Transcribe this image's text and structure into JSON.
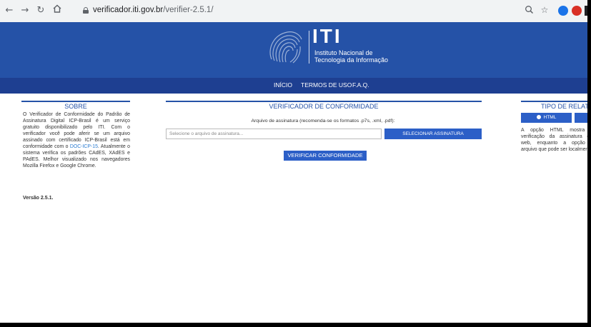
{
  "browser": {
    "url_domain": "verificador.iti.gov.br",
    "url_path": "/verifier-2.5.1/"
  },
  "header": {
    "logo_text": "ITI",
    "logo_sub_line1": "Instituto Nacional de",
    "logo_sub_line2": "Tecnologia da Informação"
  },
  "menu": [
    {
      "label": "INÍCIO"
    },
    {
      "label": "TERMOS DE USO"
    },
    {
      "label": "F.A.Q."
    }
  ],
  "about": {
    "title": "SOBRE",
    "text_before_link": "O Verificador de Conformidade do Padrão de Assinatura Digital ICP-Brasil é um serviço gratuito disponibilizado pelo ITI. Com o verificador você pode aferir se um arquivo assinado com certificado ICP-Brasil está em conformidade com o ",
    "link": "DOC-ICP-15",
    "text_after_link": ". Atualmente o sistema verifica os padrões CAdES, XAdES e PAdES. Melhor visualizado nos navegadores Mozilla Firefox e Google Chrome.",
    "version": "Versão 2.5.1."
  },
  "verifier": {
    "title": "VERIFICADOR DE CONFORMIDADE",
    "file_label": "Arquivo de assinatura (recomenda-se os formatos .p7s, .xml, .pdf):",
    "file_placeholder": "Selecione o arquivo de assinatura...",
    "select_button": "SELECIONAR ASSINATURA",
    "verify_button": "VERIFICAR CONFORMIDADE"
  },
  "report": {
    "title": "TIPO DE RELATÓ",
    "option_html": "HTML",
    "text": "A opção HTML mostra o verificação da assinatura em web, enquanto a opção F arquivo que pode ser localmente."
  },
  "colors": {
    "header_blue": "#2552a7",
    "menu_blue": "#1e3f91",
    "button_blue": "#2c5fc7",
    "link_blue": "#2a7bd1"
  }
}
